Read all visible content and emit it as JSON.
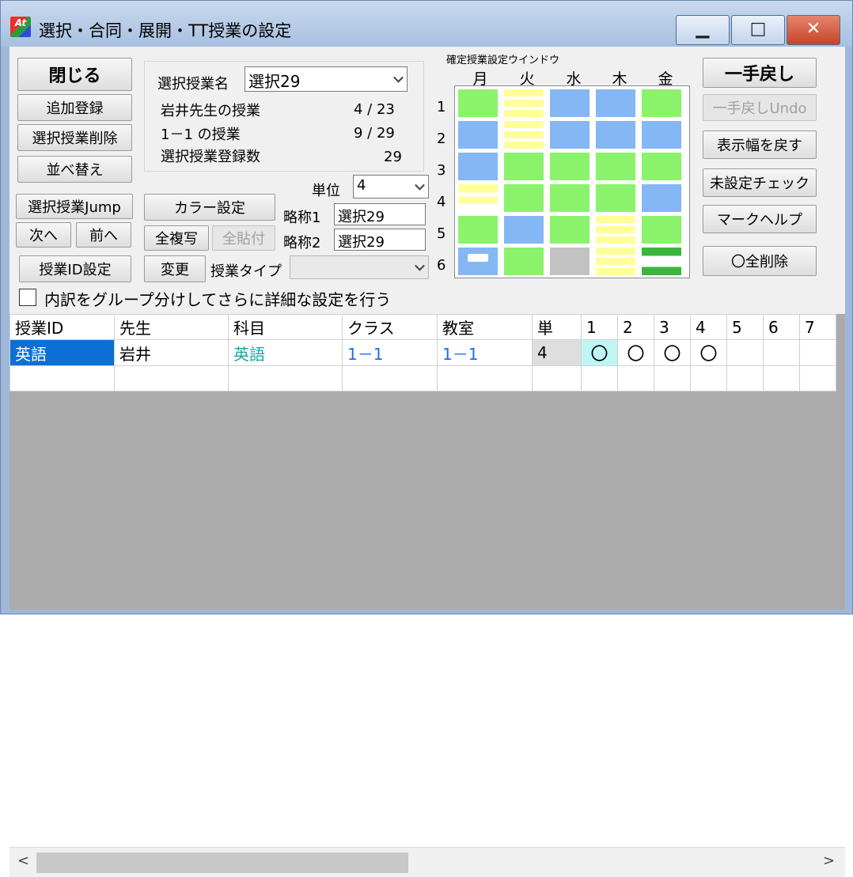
{
  "window": {
    "title": "選択・合同・展開・TT授業の設定",
    "app_icon_text": "At",
    "minimize_glyph": "▁",
    "maximize_glyph": "□",
    "close_glyph": "✕"
  },
  "left_buttons": {
    "close": "閉じる",
    "add": "追加登録",
    "delete": "選択授業削除",
    "sort": "並べ替え",
    "jump": "選択授業Jump",
    "next": "次へ",
    "prev": "前へ",
    "id_setting": "授業ID設定"
  },
  "info": {
    "name_label": "選択授業名",
    "name_value": "選択29",
    "teacher_label": "岩井先生の授業",
    "teacher_count": "4 / 23",
    "class_label": "1－1 の授業",
    "class_count": "9 / 29",
    "registered_label": "選択授業登録数",
    "registered_count": "29"
  },
  "unit": {
    "label": "単位",
    "value": "4"
  },
  "mid_buttons": {
    "color": "カラー設定",
    "copy_all": "全複写",
    "paste_all": "全貼付",
    "change": "変更"
  },
  "abbrev": {
    "label1": "略称1",
    "value1": "選択29",
    "label2": "略称2",
    "value2": "選択29"
  },
  "lesson_type": {
    "label": "授業タイプ",
    "value": ""
  },
  "timetable": {
    "title": "確定授業設定ウインドウ",
    "days": [
      "月",
      "火",
      "水",
      "木",
      "金"
    ],
    "periods": [
      "1",
      "2",
      "3",
      "4",
      "5",
      "6"
    ],
    "cells": [
      [
        "green",
        "yellow",
        "blue",
        "blue",
        "green"
      ],
      [
        "blue",
        "yellow",
        "blue",
        "blue",
        "blue"
      ],
      [
        "blue",
        "green",
        "green",
        "green",
        "green"
      ],
      [
        "ydouble",
        "green",
        "green",
        "green",
        "blue"
      ],
      [
        "green",
        "blue",
        "green",
        "yellow",
        "green"
      ],
      [
        "bluemark",
        "green",
        "gray",
        "yellow",
        "greenstripe"
      ]
    ]
  },
  "right_buttons": {
    "undo": "一手戻し",
    "redo": "一手戻しUndo",
    "reset_width": "表示幅を戻す",
    "check": "未設定チェック",
    "mark_help": "マークヘルプ",
    "clear_marks": "〇全削除"
  },
  "group_option": {
    "label": "内訳をグループ分けしてさらに詳細な設定を行う",
    "checked": false
  },
  "table": {
    "headers": [
      "授業ID",
      "先生",
      "科目",
      "クラス",
      "教室",
      "単",
      "1",
      "2",
      "3",
      "4",
      "5",
      "6",
      "7"
    ],
    "rows": [
      [
        "英語",
        "岩井",
        "英語",
        "1－1",
        "1－1",
        "4",
        "〇",
        "〇",
        "〇",
        "〇",
        "",
        "",
        ""
      ]
    ]
  },
  "scroll": {
    "left": "<",
    "right": ">"
  }
}
